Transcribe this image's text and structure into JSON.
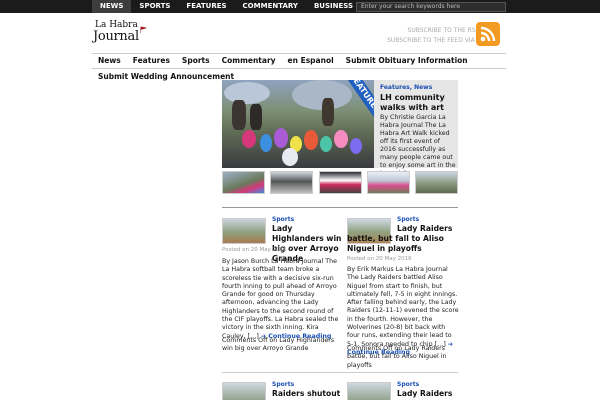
{
  "topnav": {
    "items": [
      "NEWS",
      "SPORTS",
      "FEATURES",
      "COMMENTARY",
      "BUSINESS"
    ]
  },
  "search": {
    "placeholder": "Enter your search keywords here"
  },
  "logo": {
    "line1": "La Habra",
    "line2": "Journal"
  },
  "rss": {
    "link1": "SUBSCRIBE TO THE RSS FEED",
    "link2": "SUBSCRIBE TO THE FEED VIA E-MAIL"
  },
  "mainnav": {
    "items": [
      "News",
      "Features",
      "Sports",
      "Commentary",
      "en Espanol",
      "Submit Obituary Information"
    ]
  },
  "subnav": {
    "label": "Submit Wedding Announcement"
  },
  "featured": {
    "ribbon": "FEATURED",
    "categories": "Features, News",
    "title": "LH community walks with art",
    "excerpt": "By Christie Garcia La Habra Journal The La Habra Art Walk kicked off its first event of 2016 successfully as many people came out to enjoy some art in the Imperial"
  },
  "articles": [
    {
      "category": "Sports",
      "title": "Lady Highlanders win big over Arroyo Grande",
      "date": "Posted on 20 May 2016",
      "excerpt": "By Jason Burch La Habra Journal The La Habra softball team broke a scoreless tie with a decisive six-run fourth inning to pull ahead of Arroyo Grande for good on Thursday afternoon, advancing the Lady Highlanders to the second round of the CIF playoffs. La Habra sealed the victory in the sixth inning. Kira Cauley, […]",
      "more": "Continue Reading",
      "comments": "Comments Off on Lady Highlanders win big over Arroyo Grande"
    },
    {
      "category": "Sports",
      "title": "Lady Raiders battle, but fall to Aliso Niguel in playoffs",
      "date": "Posted on 20 May 2016",
      "excerpt": "By Erik Markus La Habra Journal The Lady Raiders battled  Aliso Niguel  from start to finish, but ultimately fell, 7-5 in eight innings. After falling behind early, the Lady Raiders (12-11-1) evened the score in the fourth. However, the Wolverines (20-8) bit back with four runs, extending their lead to 5-1. Sonora needed to chip […]",
      "more": "Continue Reading",
      "comments": "Comments Off on Lady Raiders battle, but fall to Aliso Niguel in playoffs"
    },
    {
      "category": "Sports",
      "title": "Raiders shutout Estancia"
    },
    {
      "category": "Sports",
      "title": "Lady Raiders shutout Indian"
    }
  ],
  "colors": {
    "accent": "#1a4fb3",
    "topbar": "#1b1b1b",
    "ribbon": "#1f5fbf",
    "rss": "#f39a23"
  }
}
